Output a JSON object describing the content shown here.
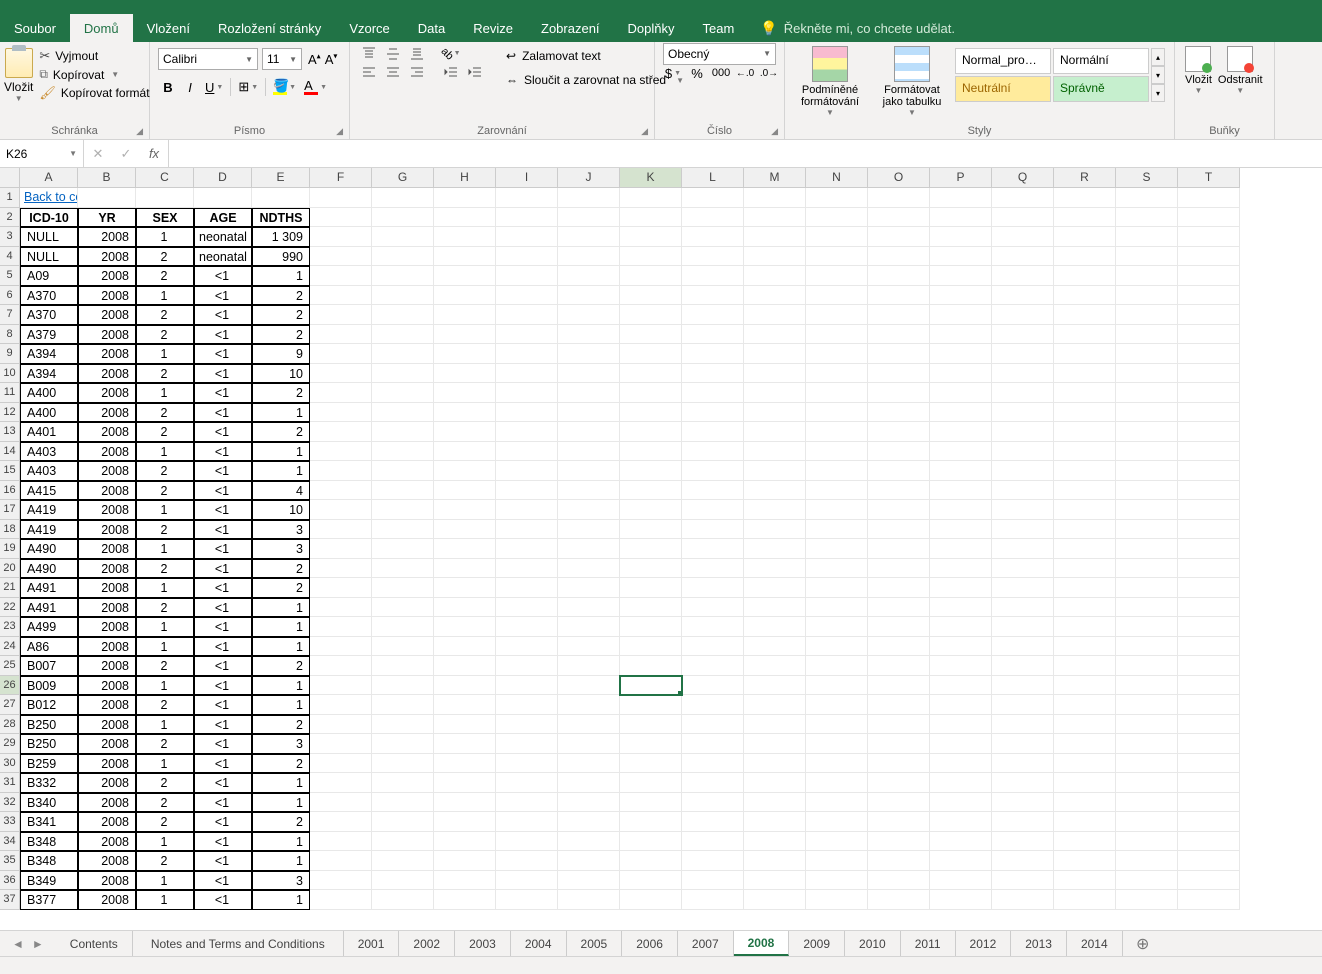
{
  "menu": {
    "tabs": [
      "Soubor",
      "Domů",
      "Vložení",
      "Rozložení stránky",
      "Vzorce",
      "Data",
      "Revize",
      "Zobrazení",
      "Doplňky",
      "Team"
    ],
    "active": "Domů",
    "tellme": "Řekněte mi, co chcete udělat."
  },
  "ribbon": {
    "clipboard": {
      "paste": "Vložit",
      "cut": "Vyjmout",
      "copy": "Kopírovat",
      "painter": "Kopírovat formát",
      "label": "Schránka"
    },
    "font": {
      "name": "Calibri",
      "size": "11",
      "label": "Písmo"
    },
    "align": {
      "wrap": "Zalamovat text",
      "merge": "Sloučit a zarovnat na střed",
      "label": "Zarovnání"
    },
    "number": {
      "format": "Obecný",
      "label": "Číslo"
    },
    "styles": {
      "cond": "Podmíněné formátování",
      "table": "Formátovat jako tabulku",
      "g1": "Normal_pro…",
      "g2": "Normální",
      "g3": "Neutrální",
      "g4": "Správně",
      "label": "Styly"
    },
    "cells": {
      "insert": "Vložit",
      "delete": "Odstranit",
      "label": "Buňky"
    }
  },
  "fbar": {
    "name": "K26",
    "formula": ""
  },
  "columns": [
    "A",
    "B",
    "C",
    "D",
    "E",
    "F",
    "G",
    "H",
    "I",
    "J",
    "K",
    "L",
    "M",
    "N",
    "O",
    "P",
    "Q",
    "R",
    "S",
    "T"
  ],
  "link_text": "Back to contents",
  "headers": [
    "ICD-10",
    "YR",
    "SEX",
    "AGE",
    "NDTHS"
  ],
  "rows": [
    [
      "NULL",
      "2008",
      "1",
      "neonatal",
      "1 309"
    ],
    [
      "NULL",
      "2008",
      "2",
      "neonatal",
      "990"
    ],
    [
      "A09",
      "2008",
      "2",
      "<1",
      "1"
    ],
    [
      "A370",
      "2008",
      "1",
      "<1",
      "2"
    ],
    [
      "A370",
      "2008",
      "2",
      "<1",
      "2"
    ],
    [
      "A379",
      "2008",
      "2",
      "<1",
      "2"
    ],
    [
      "A394",
      "2008",
      "1",
      "<1",
      "9"
    ],
    [
      "A394",
      "2008",
      "2",
      "<1",
      "10"
    ],
    [
      "A400",
      "2008",
      "1",
      "<1",
      "2"
    ],
    [
      "A400",
      "2008",
      "2",
      "<1",
      "1"
    ],
    [
      "A401",
      "2008",
      "2",
      "<1",
      "2"
    ],
    [
      "A403",
      "2008",
      "1",
      "<1",
      "1"
    ],
    [
      "A403",
      "2008",
      "2",
      "<1",
      "1"
    ],
    [
      "A415",
      "2008",
      "2",
      "<1",
      "4"
    ],
    [
      "A419",
      "2008",
      "1",
      "<1",
      "10"
    ],
    [
      "A419",
      "2008",
      "2",
      "<1",
      "3"
    ],
    [
      "A490",
      "2008",
      "1",
      "<1",
      "3"
    ],
    [
      "A490",
      "2008",
      "2",
      "<1",
      "2"
    ],
    [
      "A491",
      "2008",
      "1",
      "<1",
      "2"
    ],
    [
      "A491",
      "2008",
      "2",
      "<1",
      "1"
    ],
    [
      "A499",
      "2008",
      "1",
      "<1",
      "1"
    ],
    [
      "A86",
      "2008",
      "1",
      "<1",
      "1"
    ],
    [
      "B007",
      "2008",
      "2",
      "<1",
      "2"
    ],
    [
      "B009",
      "2008",
      "1",
      "<1",
      "1"
    ],
    [
      "B012",
      "2008",
      "2",
      "<1",
      "1"
    ],
    [
      "B250",
      "2008",
      "1",
      "<1",
      "2"
    ],
    [
      "B250",
      "2008",
      "2",
      "<1",
      "3"
    ],
    [
      "B259",
      "2008",
      "1",
      "<1",
      "2"
    ],
    [
      "B332",
      "2008",
      "2",
      "<1",
      "1"
    ],
    [
      "B340",
      "2008",
      "2",
      "<1",
      "1"
    ],
    [
      "B341",
      "2008",
      "2",
      "<1",
      "2"
    ],
    [
      "B348",
      "2008",
      "1",
      "<1",
      "1"
    ],
    [
      "B348",
      "2008",
      "2",
      "<1",
      "1"
    ],
    [
      "B349",
      "2008",
      "1",
      "<1",
      "3"
    ],
    [
      "B377",
      "2008",
      "1",
      "<1",
      "1"
    ]
  ],
  "active_cell": {
    "col": "K",
    "row": 26
  },
  "sheets": {
    "tabs": [
      "Contents",
      "Notes and Terms and Conditions",
      "2001",
      "2002",
      "2003",
      "2004",
      "2005",
      "2006",
      "2007",
      "2008",
      "2009",
      "2010",
      "2011",
      "2012",
      "2013",
      "2014"
    ],
    "active": "2008"
  }
}
